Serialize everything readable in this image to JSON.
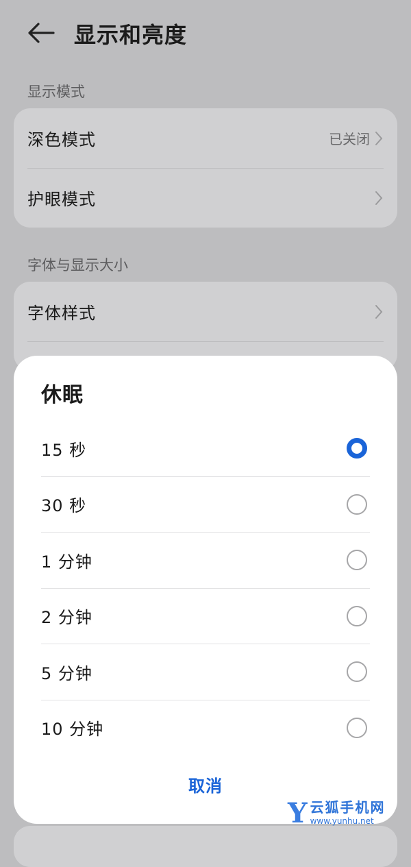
{
  "header": {
    "title": "显示和亮度"
  },
  "sections": [
    {
      "label": "显示模式",
      "items": [
        {
          "label": "深色模式",
          "value": "已关闭"
        },
        {
          "label": "护眼模式"
        }
      ]
    },
    {
      "label": "字体与显示大小",
      "items": [
        {
          "label": "字体样式"
        }
      ]
    }
  ],
  "dialog": {
    "title": "休眠",
    "options": [
      {
        "label": "15 秒",
        "selected": true
      },
      {
        "label": "30 秒",
        "selected": false
      },
      {
        "label": "1 分钟",
        "selected": false
      },
      {
        "label": "2 分钟",
        "selected": false
      },
      {
        "label": "5 分钟",
        "selected": false
      },
      {
        "label": "10 分钟",
        "selected": false
      }
    ],
    "cancel_label": "取消"
  },
  "watermark": {
    "letter": "Y",
    "text": "云狐手机网",
    "url": "www.yunhu.net"
  },
  "colors": {
    "accent": "#1a64d8",
    "background": "#bdbdbf",
    "card": "#d0d0d2"
  }
}
